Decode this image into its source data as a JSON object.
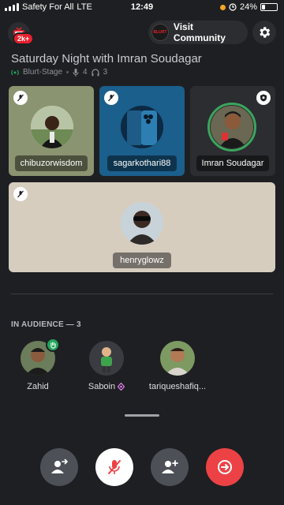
{
  "status_bar": {
    "carrier": "Safety For All",
    "network": "LTE",
    "time": "12:49",
    "battery": "24%",
    "battery_level": 0.24
  },
  "header": {
    "back_badge": "2k+",
    "visit_label": "Visit Community",
    "server_icon_text": "BLURT"
  },
  "stage": {
    "title": "Saturday Night with Imran Soudagar",
    "channel": "Blurt-Stage",
    "speakers_count": "4",
    "listeners_count": "3"
  },
  "speakers": [
    {
      "name": "chibuzorwisdom",
      "muted": true,
      "bg": "#8b9470"
    },
    {
      "name": "sagarkothari88",
      "muted": true,
      "bg": "#1b5f8c"
    },
    {
      "name": "Imran Soudagar",
      "muted": false,
      "bg": "#2b2d31",
      "moderator": true
    },
    {
      "name": "henryglowz",
      "muted": true,
      "bg": "#d6cdbf"
    }
  ],
  "audience": {
    "title": "IN AUDIENCE — 3",
    "members": [
      {
        "name": "Zahid",
        "hand_raised": true
      },
      {
        "name": "Saboin",
        "nitro": true
      },
      {
        "name": "tariqueshafiq..."
      }
    ]
  },
  "controls": {
    "leave_color": "#ed4245",
    "mic_color": "#ffffff",
    "btn_color": "#4e5058"
  }
}
